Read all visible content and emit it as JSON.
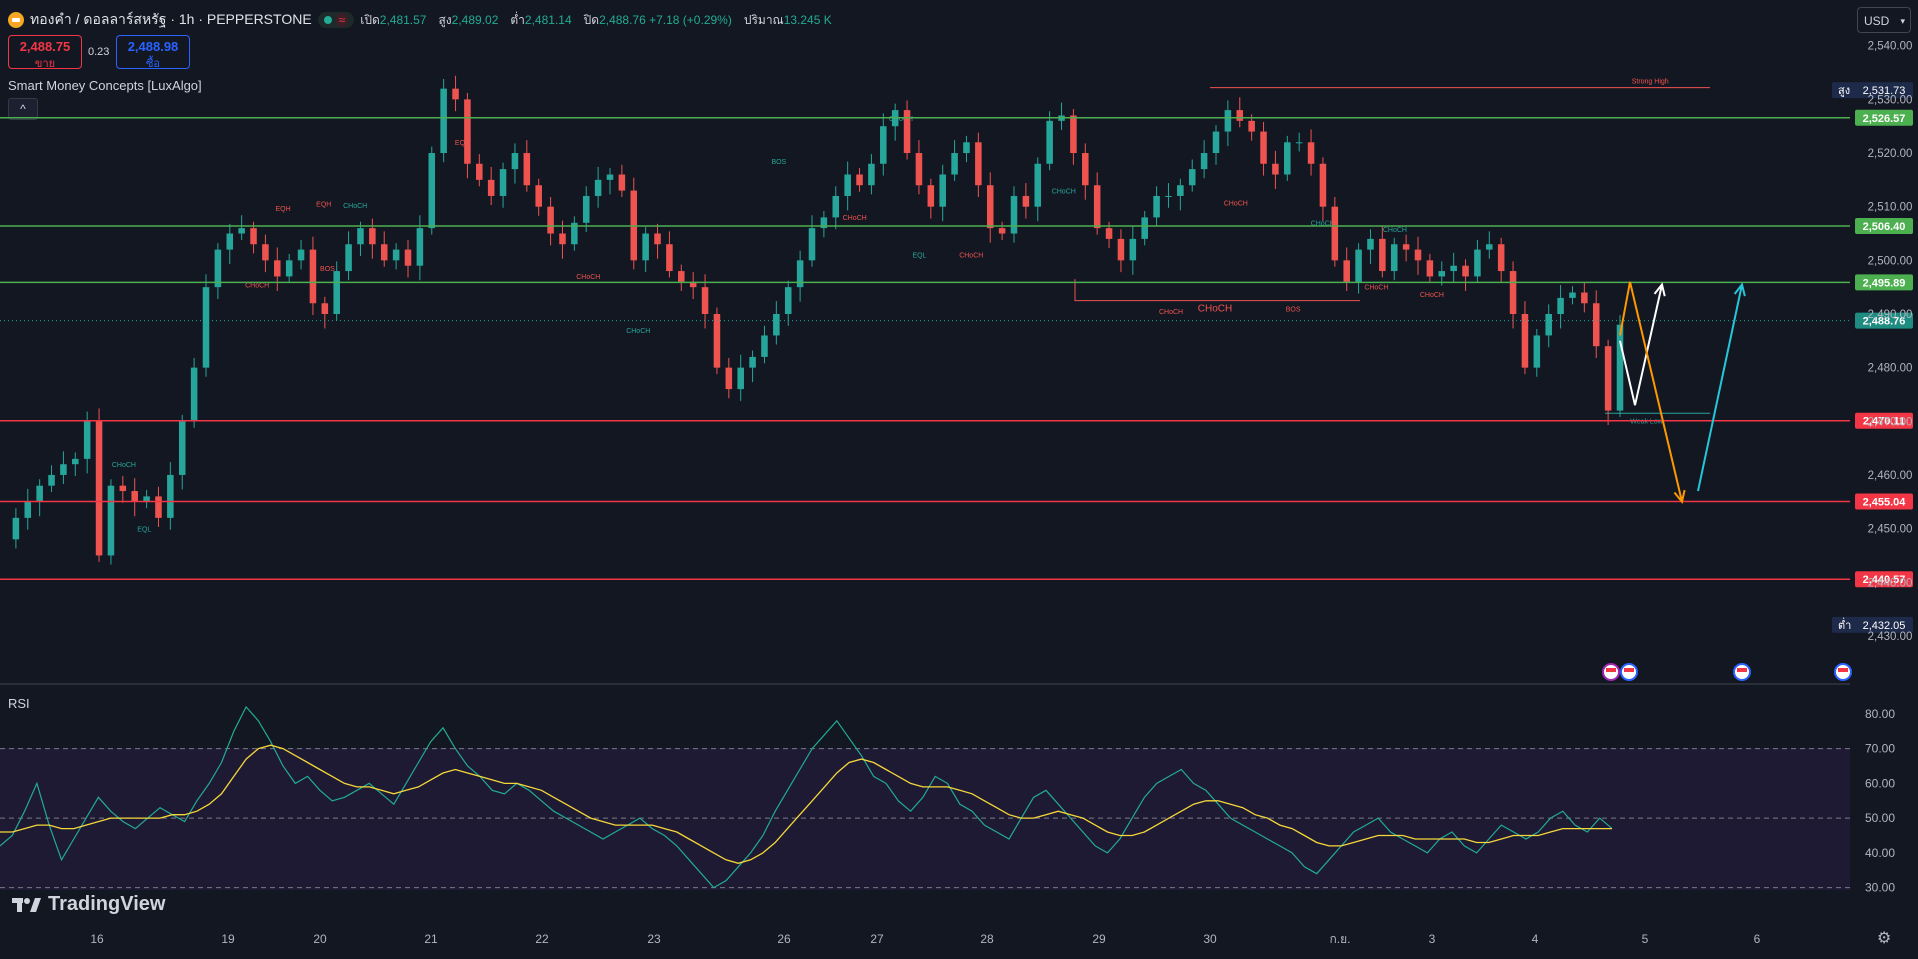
{
  "header": {
    "symbol": "ทองคำ / ดอลลาร์สหรัฐ · 1h · PEPPERSTONE",
    "status_wave": "≈",
    "ohlc": [
      {
        "k": "เปิด",
        "v": "2,481.57"
      },
      {
        "k": "สูง",
        "v": "2,489.02"
      },
      {
        "k": "ต่ำ",
        "v": "2,481.14"
      },
      {
        "k": "ปิด",
        "v": "2,488.76 +7.18 (+0.29%)"
      },
      {
        "k": "ปริมาณ",
        "v": "13.245 K"
      }
    ]
  },
  "trade": {
    "sell_price": "2,488.75",
    "sell_label": "ขาย",
    "spread": "0.23",
    "buy_price": "2,488.98",
    "buy_label": "ซื้อ"
  },
  "indicator": {
    "name": "Smart Money Concepts [LuxAlgo]",
    "collapse_icon": "^"
  },
  "currency": {
    "label": "USD",
    "chevron": "▾"
  },
  "rsi_title": "RSI",
  "logo_text": "TradingView",
  "settings_icon": "⚙",
  "colors": {
    "background": "#131722",
    "up": "#26a69a",
    "down": "#ef5350",
    "support": "#f23645",
    "resistance": "#4caf50",
    "rsi": "#22ab94",
    "rsi_ma": "#f5d73a",
    "orange": "#ff9800",
    "cyan": "#26c6da"
  },
  "chart_data": [
    {
      "type": "candlestick",
      "yaxis_ticks": [
        "2,540.00",
        "2,530.00",
        "2,520.00",
        "2,510.00",
        "2,500.00",
        "2,490.00",
        "2,480.00",
        "2,470.00",
        "2,460.00",
        "2,450.00",
        "2,440.00",
        "2,430.00"
      ],
      "ylim": [
        2427,
        2542
      ],
      "xaxis_labels": [
        "16",
        "19",
        "20",
        "21",
        "22",
        "23",
        "26",
        "27",
        "28",
        "29",
        "30",
        "ก.ย.",
        "3",
        "4",
        "5",
        "6"
      ],
      "price_path": [
        2448,
        2452,
        2455,
        2458,
        2460,
        2462,
        2463,
        2470,
        2445,
        2458,
        2457,
        2455,
        2456,
        2452,
        2460,
        2470,
        2480,
        2495,
        2502,
        2505,
        2506,
        2503,
        2500,
        2497,
        2500,
        2502,
        2492,
        2490,
        2498,
        2503,
        2506,
        2503,
        2500,
        2502,
        2499,
        2506,
        2520,
        2532,
        2530,
        2518,
        2515,
        2512,
        2517,
        2520,
        2514,
        2510,
        2505,
        2503,
        2507,
        2512,
        2515,
        2516,
        2513,
        2500,
        2505,
        2503,
        2498,
        2496,
        2495,
        2490,
        2480,
        2476,
        2480,
        2482,
        2486,
        2490,
        2495,
        2500,
        2506,
        2508,
        2512,
        2516,
        2514,
        2518,
        2525,
        2528,
        2520,
        2514,
        2510,
        2516,
        2520,
        2522,
        2514,
        2506,
        2505,
        2512,
        2510,
        2518,
        2526,
        2527,
        2520,
        2514,
        2506,
        2504,
        2500,
        2504,
        2508,
        2512,
        2512,
        2514,
        2517,
        2520,
        2524,
        2528,
        2526,
        2524,
        2518,
        2516,
        2522,
        2522,
        2518,
        2510,
        2500,
        2496,
        2502,
        2504,
        2498,
        2503,
        2502,
        2500,
        2497,
        2498,
        2499,
        2497,
        2502,
        2503,
        2498,
        2490,
        2480,
        2486,
        2490,
        2493,
        2494,
        2492,
        2484,
        2472,
        2488
      ],
      "levels": [
        {
          "price": 2526.57,
          "label": "2,526.57",
          "kind": "resistance"
        },
        {
          "price": 2506.4,
          "label": "2,506.40",
          "kind": "resistance"
        },
        {
          "price": 2495.89,
          "label": "2,495.89",
          "kind": "resistance"
        },
        {
          "price": 2470.11,
          "label": "2,470.11",
          "kind": "support"
        },
        {
          "price": 2455.04,
          "label": "2,455.04",
          "kind": "support"
        },
        {
          "price": 2440.57,
          "label": "2,440.57",
          "kind": "support"
        }
      ],
      "current_price": {
        "price": 2488.76,
        "label": "2,488.76"
      },
      "high_marker": {
        "price": 2531.73,
        "label": "2,531.73",
        "tag": "สูง"
      },
      "low_marker": {
        "price": 2432.05,
        "label": "2,432.05",
        "tag": "ต่ำ"
      },
      "annotations": [
        {
          "text": "CHoCH",
          "x": 0.067,
          "price": 2461.5,
          "color": "up"
        },
        {
          "text": "EQL",
          "x": 0.078,
          "price": 2449.5,
          "color": "up"
        },
        {
          "text": "EQH",
          "x": 0.153,
          "price": 2509.2,
          "color": "down"
        },
        {
          "text": "EQH",
          "x": 0.175,
          "price": 2510.0,
          "color": "down"
        },
        {
          "text": "CHoCH",
          "x": 0.192,
          "price": 2509.8,
          "color": "up"
        },
        {
          "text": "CHoCH",
          "x": 0.139,
          "price": 2494.9,
          "color": "down"
        },
        {
          "text": "BOS",
          "x": 0.177,
          "price": 2498.0,
          "color": "down"
        },
        {
          "text": "EQH",
          "x": 0.25,
          "price": 2521.5,
          "color": "down"
        },
        {
          "text": "CHoCH",
          "x": 0.318,
          "price": 2496.5,
          "color": "down"
        },
        {
          "text": "CHoCH",
          "x": 0.345,
          "price": 2486.5,
          "color": "up"
        },
        {
          "text": "BOS",
          "x": 0.421,
          "price": 2518.0,
          "color": "up"
        },
        {
          "text": "CHoCH",
          "x": 0.487,
          "price": 2526.0,
          "color": "up"
        },
        {
          "text": "CHoCH",
          "x": 0.462,
          "price": 2507.5,
          "color": "down"
        },
        {
          "text": "EQL",
          "x": 0.497,
          "price": 2500.5,
          "color": "up"
        },
        {
          "text": "CHoCH",
          "x": 0.525,
          "price": 2500.5,
          "color": "down"
        },
        {
          "text": "CHoCH",
          "x": 0.575,
          "price": 2512.5,
          "color": "up"
        },
        {
          "text": "CHoCH",
          "x": 0.668,
          "price": 2510.2,
          "color": "down"
        },
        {
          "text": "CHoCH",
          "x": 0.633,
          "price": 2490.0,
          "color": "down"
        },
        {
          "text": "CHoCH",
          "x": 0.715,
          "price": 2506.5,
          "color": "up"
        },
        {
          "text": "BOS",
          "x": 0.699,
          "price": 2490.5,
          "color": "down"
        },
        {
          "text": "CHoCH",
          "x": 0.754,
          "price": 2505.3,
          "color": "up"
        },
        {
          "text": "CHoCH",
          "x": 0.744,
          "price": 2494.6,
          "color": "down"
        },
        {
          "text": "CHoCH",
          "x": 0.774,
          "price": 2493.2,
          "color": "down"
        },
        {
          "text": "Strong High",
          "x": 0.892,
          "price": 2533.0,
          "color": "down"
        },
        {
          "text": "Weak Low",
          "x": 0.89,
          "price": 2469.6,
          "color": "up"
        }
      ]
    },
    {
      "type": "line",
      "title": "RSI",
      "yaxis_ticks": [
        "80.00",
        "70.00",
        "60.00",
        "50.00",
        "40.00",
        "30.00"
      ],
      "ylim": [
        25,
        84
      ],
      "band": [
        30,
        70
      ],
      "series": [
        {
          "values": [
            42,
            45,
            52,
            60,
            48,
            38,
            44,
            50,
            56,
            52,
            49,
            47,
            50,
            53,
            51,
            49,
            55,
            60,
            66,
            75,
            82,
            78,
            72,
            65,
            60,
            62,
            58,
            55,
            56,
            58,
            60,
            57,
            54,
            60,
            66,
            72,
            76,
            70,
            65,
            62,
            58,
            57,
            60,
            58,
            55,
            52,
            50,
            48,
            46,
            44,
            46,
            48,
            50,
            47,
            45,
            42,
            38,
            34,
            30,
            32,
            36,
            40,
            45,
            52,
            58,
            64,
            70,
            74,
            78,
            73,
            68,
            62,
            60,
            55,
            52,
            56,
            62,
            60,
            54,
            52,
            48,
            46,
            44,
            50,
            56,
            58,
            54,
            50,
            46,
            42,
            40,
            44,
            50,
            56,
            60,
            62,
            64,
            60,
            58,
            54,
            50,
            48,
            46,
            44,
            42,
            40,
            36,
            34,
            38,
            42,
            46,
            48,
            50,
            46,
            44,
            42,
            40,
            44,
            46,
            42,
            40,
            44,
            48,
            46,
            44,
            46,
            50,
            52,
            48,
            46,
            50,
            47
          ]
        },
        {
          "values": [
            46,
            46,
            47,
            48,
            48,
            47,
            47,
            48,
            49,
            50,
            50,
            50,
            50,
            50,
            51,
            51,
            52,
            54,
            57,
            62,
            67,
            70,
            71,
            70,
            68,
            66,
            64,
            62,
            60,
            59,
            59,
            58,
            57,
            58,
            59,
            61,
            63,
            64,
            63,
            62,
            61,
            60,
            60,
            59,
            58,
            56,
            54,
            52,
            50,
            49,
            48,
            48,
            48,
            48,
            47,
            46,
            44,
            42,
            40,
            38,
            37,
            38,
            40,
            43,
            47,
            51,
            55,
            59,
            63,
            66,
            67,
            66,
            64,
            62,
            60,
            59,
            59,
            59,
            58,
            57,
            55,
            53,
            51,
            50,
            50,
            51,
            52,
            51,
            50,
            48,
            46,
            45,
            45,
            46,
            48,
            50,
            52,
            54,
            55,
            55,
            54,
            53,
            51,
            50,
            48,
            47,
            45,
            43,
            42,
            42,
            43,
            44,
            45,
            45,
            45,
            44,
            44,
            44,
            44,
            44,
            43,
            43,
            44,
            45,
            45,
            45,
            46,
            47,
            47,
            47,
            47,
            47
          ]
        }
      ]
    }
  ]
}
